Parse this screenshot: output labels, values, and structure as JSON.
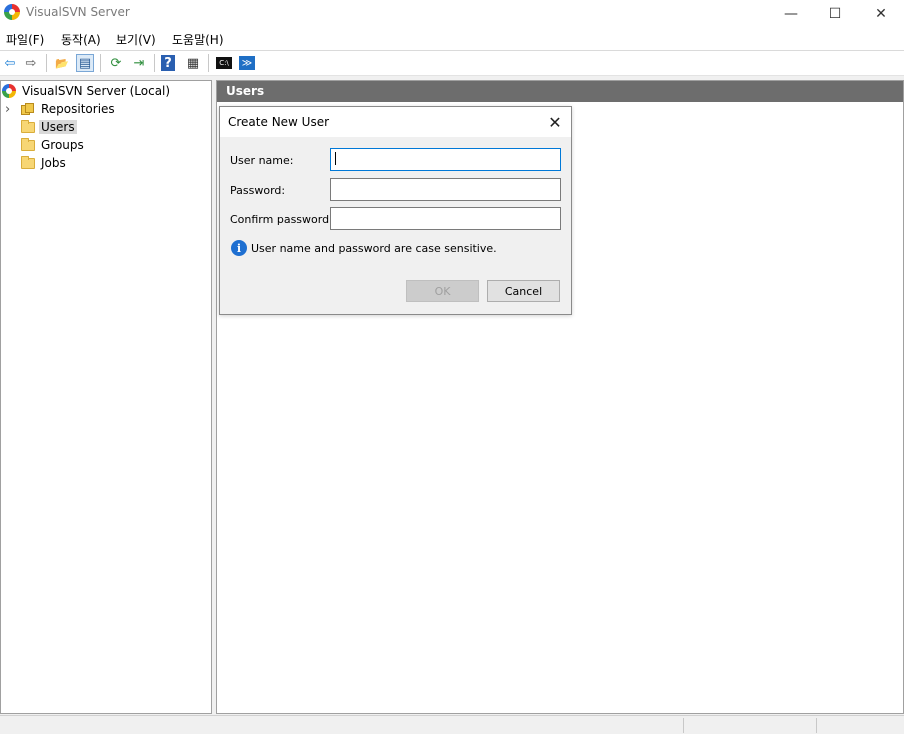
{
  "window": {
    "title": "VisualSVN Server",
    "minimize": "—",
    "maximize": "☐",
    "close": "✕"
  },
  "menu": [
    "파일(F)",
    "동작(A)",
    "보기(V)",
    "도움말(H)"
  ],
  "toolbar": {
    "back": "⇦",
    "forward": "⇨",
    "up": "📂",
    "show_tree": "▤",
    "refresh": "⟳",
    "export": "⇥",
    "help": "?",
    "properties": "▦",
    "console": "C:\\",
    "powershell": "≫"
  },
  "tree": {
    "root": "VisualSVN Server (Local)",
    "expander": "›",
    "items": [
      {
        "label": "Repositories"
      },
      {
        "label": "Users"
      },
      {
        "label": "Groups"
      },
      {
        "label": "Jobs"
      }
    ]
  },
  "pane": {
    "header": "Users"
  },
  "dialog": {
    "title": "Create New User",
    "close": "✕",
    "fields": [
      {
        "label": "User name:",
        "value": ""
      },
      {
        "label": "Password:",
        "value": ""
      },
      {
        "label": "Confirm password:",
        "value": ""
      }
    ],
    "info_icon": "i",
    "info": "User name and password are case sensitive.",
    "ok": "OK",
    "cancel": "Cancel"
  }
}
